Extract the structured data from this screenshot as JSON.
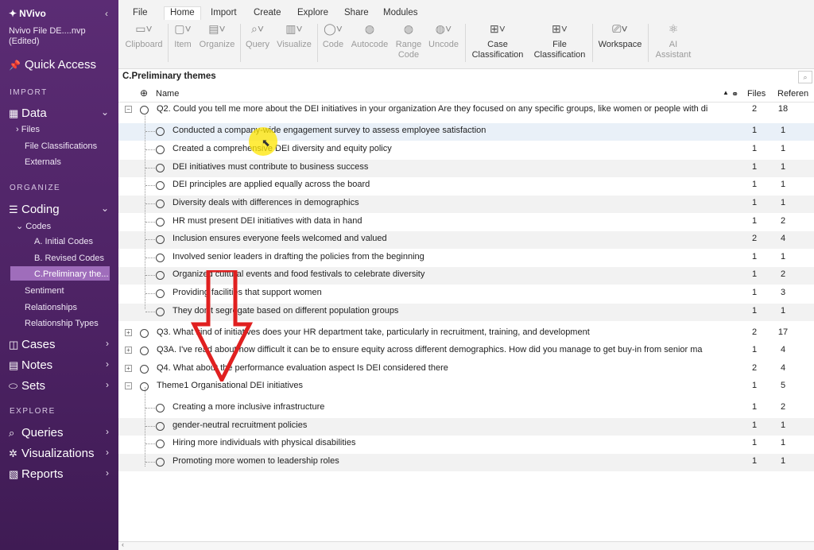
{
  "app": {
    "brand": "NVivo",
    "project": "Nvivo File DE....nvp (Edited)"
  },
  "sidebar": {
    "quick_access": "Quick Access",
    "import_label": "IMPORT",
    "data": "Data",
    "files": "Files",
    "file_classifications": "File Classifications",
    "externals": "Externals",
    "organize_label": "ORGANIZE",
    "coding": "Coding",
    "codes": "Codes",
    "initial_codes": "A. Initial Codes",
    "revised_codes": "B. Revised Codes",
    "preliminary": "C.Preliminary the...",
    "sentiment": "Sentiment",
    "relationships": "Relationships",
    "relationship_types": "Relationship Types",
    "cases": "Cases",
    "notes": "Notes",
    "sets": "Sets",
    "explore_label": "EXPLORE",
    "queries": "Queries",
    "visualizations": "Visualizations",
    "reports": "Reports"
  },
  "ribbon": {
    "tabs": [
      "File",
      "Home",
      "Import",
      "Create",
      "Explore",
      "Share",
      "Modules"
    ],
    "clipboard": "Clipboard",
    "item": "Item",
    "organize": "Organize",
    "query": "Query",
    "visualize": "Visualize",
    "code": "Code",
    "autocode": "Autocode",
    "range_code_1": "Range",
    "range_code_2": "Code",
    "uncode": "Uncode",
    "case_1": "Case",
    "case_2": "Classification",
    "file_1": "File",
    "file_2": "Classification",
    "workspace": "Workspace",
    "ai_1": "AI",
    "ai_2": "Assistant"
  },
  "list": {
    "title": "C.Preliminary themes",
    "col_name": "Name",
    "col_files": "Files",
    "col_refs": "Referen",
    "rows": [
      {
        "name": "Q2. Could you tell me more about the DEI initiatives in your organization Are they focused on any specific groups, like women or people with di",
        "files": "2",
        "refs": "18"
      },
      {
        "name": "Conducted a company-wide engagement survey to assess employee satisfaction",
        "files": "1",
        "refs": "1"
      },
      {
        "name": "Created a comprehensive DEI diversity and equity policy",
        "files": "1",
        "refs": "1"
      },
      {
        "name": "DEI initiatives must contribute to business success",
        "files": "1",
        "refs": "1"
      },
      {
        "name": "DEI principles are applied equally across the board",
        "files": "1",
        "refs": "1"
      },
      {
        "name": "Diversity deals with differences in demographics",
        "files": "1",
        "refs": "1"
      },
      {
        "name": "HR must present DEI initiatives with data in hand",
        "files": "1",
        "refs": "2"
      },
      {
        "name": "Inclusion ensures everyone feels welcomed and valued",
        "files": "2",
        "refs": "4"
      },
      {
        "name": "Involved senior leaders in drafting the policies from the beginning",
        "files": "1",
        "refs": "1"
      },
      {
        "name": "Organized cultural events and food festivals to celebrate diversity",
        "files": "1",
        "refs": "2"
      },
      {
        "name": "Providing facilities that support women",
        "files": "1",
        "refs": "3"
      },
      {
        "name": "They don't segregate based on different population groups",
        "files": "1",
        "refs": "1"
      },
      {
        "name": "Q3. What kind of initiatives does your HR department take, particularly in recruitment, training, and development",
        "files": "2",
        "refs": "17"
      },
      {
        "name": "Q3A. I've read about how difficult it can be to ensure equity across different demographics. How did you manage to get buy-in from senior ma",
        "files": "1",
        "refs": "4"
      },
      {
        "name": "Q4. What about the performance evaluation aspect Is DEI considered there",
        "files": "2",
        "refs": "4"
      },
      {
        "name": "Theme1 Organisational DEI initiatives",
        "files": "1",
        "refs": "5"
      },
      {
        "name": "Creating a more inclusive infrastructure",
        "files": "1",
        "refs": "2"
      },
      {
        "name": "gender-neutral recruitment policies",
        "files": "1",
        "refs": "1"
      },
      {
        "name": "Hiring more individuals with physical disabilities",
        "files": "1",
        "refs": "1"
      },
      {
        "name": "Promoting more women to leadership roles",
        "files": "1",
        "refs": "1"
      }
    ]
  },
  "colors": {
    "sidebar": "#4c2263",
    "selection": "#9f6dbb",
    "arrow": "#e02020",
    "cursor_highlight": "#ffe600"
  }
}
